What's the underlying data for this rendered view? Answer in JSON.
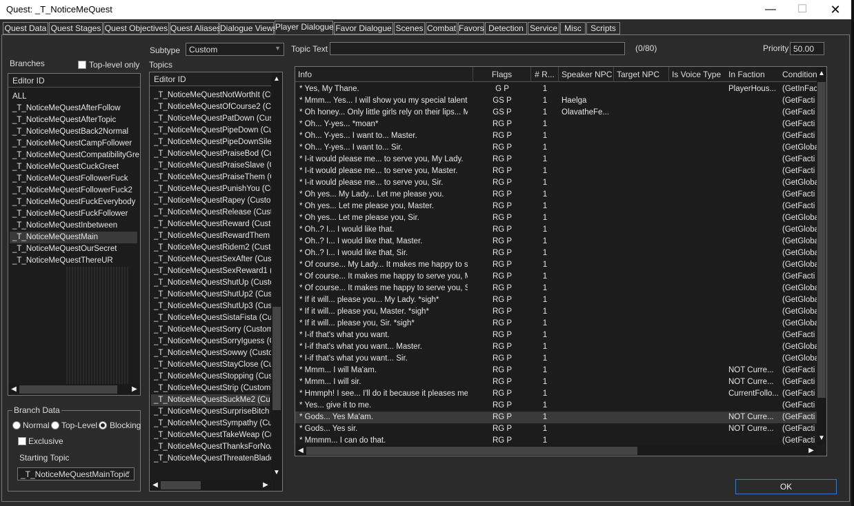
{
  "window": {
    "title": "Quest: _T_NoticeMeQuest",
    "min": "—",
    "max": "☐",
    "close": "✕"
  },
  "tabs": [
    "Quest Data",
    "Quest Stages",
    "Quest Objectives",
    "Quest Aliases",
    "Dialogue Views",
    "Player Dialogue",
    "Favor Dialogue",
    "Scenes",
    "Combat",
    "Favors",
    "Detection",
    "Service",
    "Misc",
    "Scripts"
  ],
  "active_tab": "Player Dialogue",
  "subtype": {
    "label": "Subtype",
    "value": "Custom"
  },
  "topic_text": {
    "label": "Topic Text",
    "value": "",
    "counter": "(0/80)"
  },
  "priority": {
    "label": "Priority",
    "value": "50.00"
  },
  "branches": {
    "label": "Branches",
    "toplevel_only_label": "Top-level only",
    "header": "Editor ID",
    "items": [
      "ALL",
      "_T_NoticeMeQuestAfterFollow",
      "_T_NoticeMeQuestAfterTopic",
      "_T_NoticeMeQuestBack2Normal",
      "_T_NoticeMeQuestCampFollower",
      "_T_NoticeMeQuestCompatibilityGre...",
      "_T_NoticeMeQuestCuckGreet",
      "_T_NoticeMeQuestFollowerFuck",
      "_T_NoticeMeQuestFollowerFuck2",
      "_T_NoticeMeQuestFuckEverybody",
      "_T_NoticeMeQuestFuckFollower",
      "_T_NoticeMeQuestInbetween",
      "_T_NoticeMeQuestMain",
      "_T_NoticeMeQuestOurSecret",
      "_T_NoticeMeQuestThereUR"
    ],
    "selected_index": 12
  },
  "branch_data": {
    "title": "Branch Data",
    "normal": "Normal",
    "toplevel": "Top-Level",
    "blocking": "Blocking",
    "exclusive": "Exclusive",
    "starting_topic_label": "Starting Topic",
    "starting_topic": "_T_NoticeMeQuestMainTopic"
  },
  "topics": {
    "label": "Topics",
    "header": "Editor ID",
    "items": [
      "_T_NoticeMeQuestNotWorthIt (Cus",
      "_T_NoticeMeQuestOfCourse2 (Cust",
      "_T_NoticeMeQuestPatDown (Custo",
      "_T_NoticeMeQuestPipeDown (Cust",
      "_T_NoticeMeQuestPipeDownSilent",
      "_T_NoticeMeQuestPraiseBod (Cust",
      "_T_NoticeMeQuestPraiseSlave (Cu",
      "_T_NoticeMeQuestPraiseThem (Cu",
      "_T_NoticeMeQuestPunishYou (Cust",
      "_T_NoticeMeQuestRapey (Custom)",
      "_T_NoticeMeQuestRelease (Custom",
      "_T_NoticeMeQuestReward (Custom",
      "_T_NoticeMeQuestRewardThem (C",
      "_T_NoticeMeQuestRidem2 (Custom",
      "_T_NoticeMeQuestSexAfter (Custon",
      "_T_NoticeMeQuestSexReward1 (Cu",
      "_T_NoticeMeQuestShutUp (Custom",
      "_T_NoticeMeQuestShutUp2 (Custor",
      "_T_NoticeMeQuestShutUp3 (Custo",
      "_T_NoticeMeQuestSistaFista (Custo",
      "_T_NoticeMeQuestSorry (Custom)",
      "_T_NoticeMeQuestSorryIguess (Cus",
      "_T_NoticeMeQuestSowwy (Custom)",
      "_T_NoticeMeQuestStayClose (Cust",
      "_T_NoticeMeQuestStopping (Custo",
      "_T_NoticeMeQuestStrip (Custom)",
      "_T_NoticeMeQuestSuckMe2 (Custo",
      "_T_NoticeMeQuestSurpriseBitch (Cr",
      "_T_NoticeMeQuestSympathy (Custo",
      "_T_NoticeMeQuestTakeWeap (Cus",
      "_T_NoticeMeQuestThanksForNoAr",
      "_T_NoticeMeQuestThreatenBlade ("
    ],
    "selected_index": 26
  },
  "grid": {
    "headers": [
      "Info",
      "Flags",
      "# R...",
      "Speaker NPC",
      "Target NPC",
      "Is Voice Type",
      "In Faction",
      "Conditions"
    ],
    "rows": [
      [
        "* Yes, My Thane.",
        "G  P",
        "1",
        "",
        "",
        "",
        "PlayerHous...",
        "(GetInFac"
      ],
      [
        "* Mmm... Yes... I will show you my special talents....",
        "GS P",
        "1",
        "Haelga",
        "",
        "",
        "",
        "(GetFacti"
      ],
      [
        "* Oh honey... Only little girls rely on their lips... My ...",
        "GS P",
        "1",
        "OlavatheFe...",
        "",
        "",
        "",
        "(GetFacti"
      ],
      [
        "* Oh... Y-yes... *moan*",
        "RG  P",
        "1",
        "",
        "",
        "",
        "",
        "(GetFacti"
      ],
      [
        "* Oh... Y-yes... I want to... Master.",
        "RG  P",
        "1",
        "",
        "",
        "",
        "",
        "(GetFacti"
      ],
      [
        "* Oh... Y-yes... I want to... Sir.",
        "RG  P",
        "1",
        "",
        "",
        "",
        "",
        "(GetGloba"
      ],
      [
        "* I-it would please me... to serve you, My Lady.",
        "RG  P",
        "1",
        "",
        "",
        "",
        "",
        "(GetFacti"
      ],
      [
        "* I-it would please me... to serve you, Master.",
        "RG  P",
        "1",
        "",
        "",
        "",
        "",
        "(GetFacti"
      ],
      [
        "* I-it would please me... to serve you, Sir.",
        "RG  P",
        "1",
        "",
        "",
        "",
        "",
        "(GetGloba"
      ],
      [
        "* Oh yes... My Lady... Let me please you.",
        "RG  P",
        "1",
        "",
        "",
        "",
        "",
        "(GetFacti"
      ],
      [
        "* Oh yes... Let me please you, Master.",
        "RG  P",
        "1",
        "",
        "",
        "",
        "",
        "(GetFacti"
      ],
      [
        "* Oh yes... Let me please you, Sir.",
        "RG  P",
        "1",
        "",
        "",
        "",
        "",
        "(GetGloba"
      ],
      [
        "* Oh..?  I... I would like that.",
        "RG  P",
        "1",
        "",
        "",
        "",
        "",
        "(GetGloba"
      ],
      [
        "* Oh..?  I... I would like that, Master.",
        "RG  P",
        "1",
        "",
        "",
        "",
        "",
        "(GetGloba"
      ],
      [
        "* Oh..?  I... I would like that, Sir.",
        "RG  P",
        "1",
        "",
        "",
        "",
        "",
        "(GetGloba"
      ],
      [
        "* Of course... My Lady... It makes me happy to se...",
        "RG  P",
        "1",
        "",
        "",
        "",
        "",
        "(GetGloba"
      ],
      [
        "* Of course... It makes me happy to serve you, M...",
        "RG  P",
        "1",
        "",
        "",
        "",
        "",
        "(GetFacti"
      ],
      [
        "* Of course... It makes me happy to serve you, Sir.",
        "RG  P",
        "1",
        "",
        "",
        "",
        "",
        "(GetGloba"
      ],
      [
        "* If it will... please you... My Lady. *sigh*",
        "RG  P",
        "1",
        "",
        "",
        "",
        "",
        "(GetGloba"
      ],
      [
        "* If it will... please you, Master. *sigh*",
        "RG  P",
        "1",
        "",
        "",
        "",
        "",
        "(GetGloba"
      ],
      [
        "* If it will... please you, Sir. *sigh*",
        "RG  P",
        "1",
        "",
        "",
        "",
        "",
        "(GetGloba"
      ],
      [
        "* I-if that's what you want.",
        "RG  P",
        "1",
        "",
        "",
        "",
        "",
        "(GetFacti"
      ],
      [
        "* I-if that's what you want... Master.",
        "RG  P",
        "1",
        "",
        "",
        "",
        "",
        "(GetGloba"
      ],
      [
        "* I-if that's what you want... Sir.",
        "RG  P",
        "1",
        "",
        "",
        "",
        "",
        "(GetGloba"
      ],
      [
        "* Mmm... I will Ma'am.",
        "RG  P",
        "1",
        "",
        "",
        "",
        "NOT Curre...",
        "(GetFacti"
      ],
      [
        "* Mmm... I will sir.",
        "RG  P",
        "1",
        "",
        "",
        "",
        "NOT Curre...",
        "(GetFacti"
      ],
      [
        "* Hmmph! I see... I'll do it because it pleases me t...",
        "RG  P",
        "1",
        "",
        "",
        "",
        "CurrentFollo...",
        "(GetFacti"
      ],
      [
        "* Yes... give it to me.",
        "RG  P",
        "1",
        "",
        "",
        "",
        "",
        "(GetFacti"
      ],
      [
        "* Gods... Yes Ma'am.",
        "RG  P",
        "1",
        "",
        "",
        "",
        "NOT Curre...",
        "(GetFacti"
      ],
      [
        "* Gods... Yes sir.",
        "RG  P",
        "1",
        "",
        "",
        "",
        "NOT Curre...",
        "(GetFacti"
      ],
      [
        "* Mmmm... I can do that.",
        "RG  P",
        "1",
        "",
        "",
        "",
        "",
        "(GetFacti"
      ]
    ],
    "selected_index": 28
  },
  "ok_label": "OK"
}
